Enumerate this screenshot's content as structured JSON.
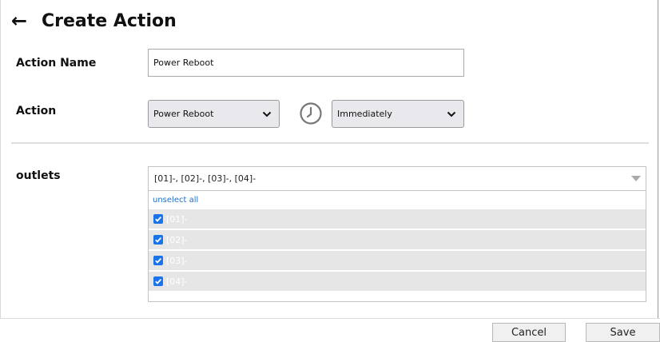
{
  "header": {
    "title": "Create Action",
    "back_icon": "arrow-left-icon"
  },
  "form": {
    "action_name_label": "Action Name",
    "action_name_value": "Power Reboot",
    "action_label": "Action",
    "action_select_value": "Power Reboot",
    "timing_select_value": "Immediately",
    "clock_icon": "clock-icon",
    "outlets_label": "outlets",
    "outlets_summary": "[01]-, [02]-, [03]-, [04]-",
    "unselect_all": "unselect all",
    "outlet_options": [
      {
        "label": "[01]-",
        "checked": true
      },
      {
        "label": "[02]-",
        "checked": true
      },
      {
        "label": "[03]-",
        "checked": true
      },
      {
        "label": "[04]-",
        "checked": true
      }
    ]
  },
  "footer": {
    "cancel_label": "Cancel",
    "save_label": "Save"
  },
  "colors": {
    "checkbox": "#1a73e8",
    "link": "#1a6fc4",
    "option_bg": "#e6e6e6"
  }
}
